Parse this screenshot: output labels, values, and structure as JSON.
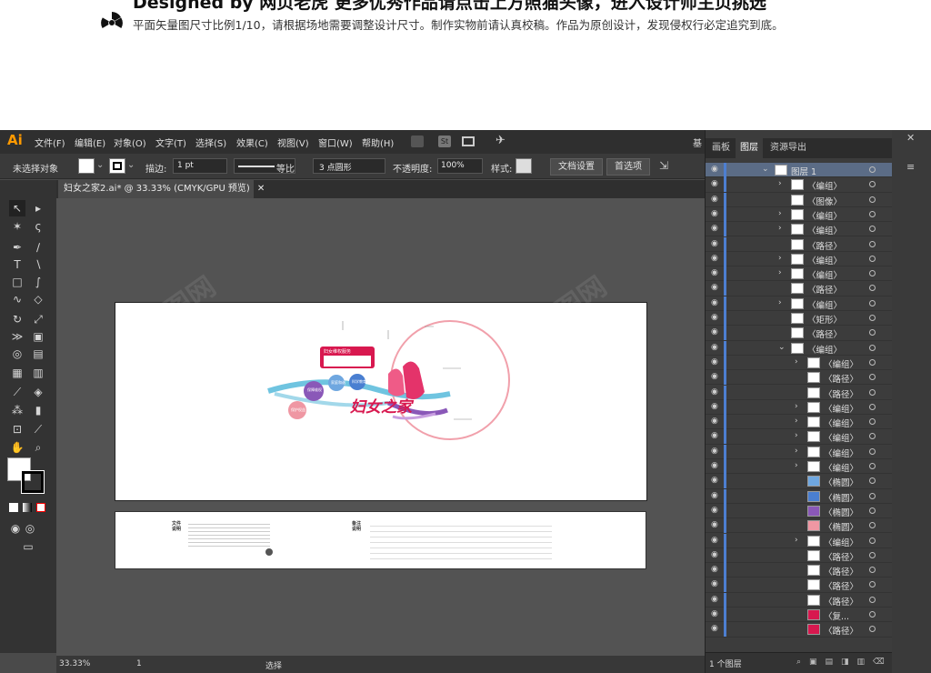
{
  "banner": {
    "headline": "Designed by 网页老虎     更多优秀作品请点击上方照猫头像，进入设计师主页挑选",
    "note": "平面矢量图尺寸比例1/10，请根据场地需要调整设计尺寸。制作实物前请认真校稿。作品为原创设计，发现侵权行必定追究到底。"
  },
  "app": {
    "logo": "Ai",
    "menu": [
      "文件(F)",
      "编辑(E)",
      "对象(O)",
      "文字(T)",
      "选择(S)",
      "效果(C)",
      "视图(V)",
      "窗口(W)",
      "帮助(H)"
    ],
    "menu_right_label": "基",
    "control": {
      "selection": "未选择对象",
      "stroke_label": "描边:",
      "stroke_value": "1 pt",
      "stroke_style": "等比",
      "brush_value": "3 点圆形",
      "opacity_label": "不透明度:",
      "opacity_value": "100%",
      "style_label": "样式:",
      "doc_settings": "文档设置",
      "preferences": "首选项"
    },
    "doc_tab": "妇女之家2.ai* @ 33.33% (CMYK/GPU 预览)",
    "status": {
      "zoom": "33.33%",
      "page": "1",
      "mode": "选择"
    },
    "artboard": {
      "title": "妇女之家",
      "bubbles": [
        "保障维权",
        "家庭和谐",
        "科学教育",
        "保护权益"
      ],
      "banner_title": "妇女维权服务"
    },
    "artboard2": {
      "label1": "文件说明",
      "label2": "备注说明"
    }
  },
  "panel": {
    "tabs": [
      "画板",
      "图层",
      "资源导出"
    ],
    "footer": "1 个图层",
    "layers": [
      {
        "label": "图层 1",
        "indent": 0,
        "expanded": true,
        "selected": true
      },
      {
        "label": "〈编组〉",
        "indent": 1,
        "chev": true
      },
      {
        "label": "〈图像〉",
        "indent": 1,
        "chev": false
      },
      {
        "label": "〈编组〉",
        "indent": 1,
        "chev": true
      },
      {
        "label": "〈编组〉",
        "indent": 1,
        "chev": true
      },
      {
        "label": "〈路径〉",
        "indent": 1,
        "chev": false
      },
      {
        "label": "〈编组〉",
        "indent": 1,
        "chev": true
      },
      {
        "label": "〈编组〉",
        "indent": 1,
        "chev": true
      },
      {
        "label": "〈路径〉",
        "indent": 1,
        "chev": false
      },
      {
        "label": "〈编组〉",
        "indent": 1,
        "chev": true
      },
      {
        "label": "〈矩形〉",
        "indent": 1,
        "chev": false
      },
      {
        "label": "〈路径〉",
        "indent": 1,
        "chev": false
      },
      {
        "label": "〈编组〉",
        "indent": 1,
        "expanded": true
      },
      {
        "label": "〈编组〉",
        "indent": 2,
        "chev": true
      },
      {
        "label": "〈路径〉",
        "indent": 2,
        "chev": false
      },
      {
        "label": "〈路径〉",
        "indent": 2,
        "chev": false
      },
      {
        "label": "〈编组〉",
        "indent": 2,
        "chev": true
      },
      {
        "label": "〈编组〉",
        "indent": 2,
        "chev": true
      },
      {
        "label": "〈编组〉",
        "indent": 2,
        "chev": true
      },
      {
        "label": "〈编组〉",
        "indent": 2,
        "chev": true
      },
      {
        "label": "〈编组〉",
        "indent": 2,
        "chev": true
      },
      {
        "label": "〈椭圆〉",
        "indent": 2,
        "chev": false,
        "thumb": "#6fa7e0"
      },
      {
        "label": "〈椭圆〉",
        "indent": 2,
        "chev": false,
        "thumb": "#4a7fd1"
      },
      {
        "label": "〈椭圆〉",
        "indent": 2,
        "chev": false,
        "thumb": "#8a58b8"
      },
      {
        "label": "〈椭圆〉",
        "indent": 2,
        "chev": false,
        "thumb": "#ef97a3"
      },
      {
        "label": "〈编组〉",
        "indent": 2,
        "chev": true
      },
      {
        "label": "〈路径〉",
        "indent": 2,
        "chev": false
      },
      {
        "label": "〈路径〉",
        "indent": 2,
        "chev": false
      },
      {
        "label": "〈路径〉",
        "indent": 2,
        "chev": false
      },
      {
        "label": "〈路径〉",
        "indent": 2,
        "chev": false
      },
      {
        "label": "〈复...",
        "indent": 2,
        "chev": false,
        "thumb": "#d8184f"
      },
      {
        "label": "〈路径〉",
        "indent": 2,
        "chev": false,
        "thumb": "#d8184f"
      }
    ]
  }
}
